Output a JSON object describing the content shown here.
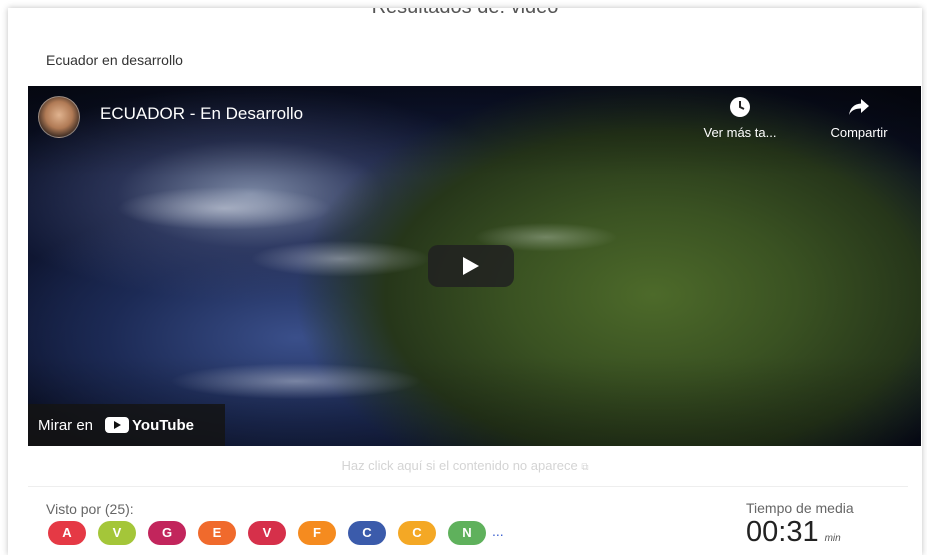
{
  "header": {
    "title": "Resultados de: video"
  },
  "activity": {
    "title": "Ecuador en desarrollo"
  },
  "video": {
    "title": "ECUADOR - En Desarrollo",
    "watch_later_label": "Ver más ta...",
    "share_label": "Compartir",
    "watch_on_label": "Mirar en",
    "youtube_label": "YouTube"
  },
  "fallback_link": "Haz click aquí si el contenido no aparece",
  "viewers": {
    "label": "Visto por (25):",
    "items": [
      {
        "initial": "A",
        "color": "#e53945"
      },
      {
        "initial": "V",
        "color": "#a4c639"
      },
      {
        "initial": "G",
        "color": "#c2255c"
      },
      {
        "initial": "E",
        "color": "#f06a2c"
      },
      {
        "initial": "V",
        "color": "#d6304a"
      },
      {
        "initial": "F",
        "color": "#f58b1f"
      },
      {
        "initial": "C",
        "color": "#3b5bab"
      },
      {
        "initial": "C",
        "color": "#f4a825"
      },
      {
        "initial": "N",
        "color": "#5fb15c"
      }
    ],
    "more": "..."
  },
  "media_time": {
    "label": "Tiempo de media",
    "value": "00:31",
    "unit": "min"
  }
}
